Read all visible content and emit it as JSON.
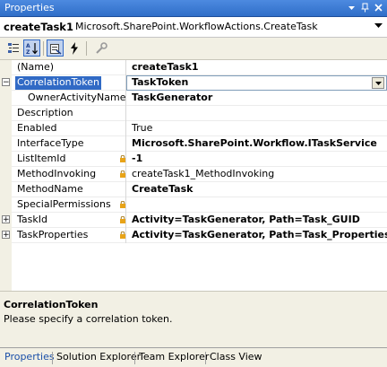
{
  "window": {
    "title": "Properties"
  },
  "object_selector": {
    "name": "createTask1",
    "type": "Microsoft.SharePoint.WorkflowActions.CreateTask"
  },
  "toolbar": {
    "buttons": [
      "categorized-icon",
      "alphabetical-icon",
      "properties-icon",
      "events-icon",
      "property-pages-icon"
    ]
  },
  "properties": [
    {
      "name": "(Name)",
      "value": "createTask1",
      "bold": true,
      "expander": "",
      "lock": false,
      "indent": false,
      "selected": false
    },
    {
      "name": "CorrelationToken",
      "value": "TaskToken",
      "bold": true,
      "expander": "−",
      "lock": false,
      "indent": false,
      "selected": true
    },
    {
      "name": "OwnerActivityName",
      "value": "TaskGenerator",
      "bold": true,
      "expander": "",
      "lock": false,
      "indent": true,
      "selected": false
    },
    {
      "name": "Description",
      "value": "",
      "bold": false,
      "expander": "",
      "lock": false,
      "indent": false,
      "selected": false
    },
    {
      "name": "Enabled",
      "value": "True",
      "bold": false,
      "expander": "",
      "lock": false,
      "indent": false,
      "selected": false
    },
    {
      "name": "InterfaceType",
      "value": "Microsoft.SharePoint.Workflow.ITaskService",
      "bold": true,
      "expander": "",
      "lock": false,
      "indent": false,
      "selected": false
    },
    {
      "name": "ListItemId",
      "value": "-1",
      "bold": true,
      "expander": "",
      "lock": true,
      "indent": false,
      "selected": false
    },
    {
      "name": "MethodInvoking",
      "value": "createTask1_MethodInvoking",
      "bold": false,
      "expander": "",
      "lock": true,
      "indent": false,
      "selected": false
    },
    {
      "name": "MethodName",
      "value": "CreateTask",
      "bold": true,
      "expander": "",
      "lock": false,
      "indent": false,
      "selected": false
    },
    {
      "name": "SpecialPermissions",
      "value": "",
      "bold": false,
      "expander": "",
      "lock": true,
      "indent": false,
      "selected": false
    },
    {
      "name": "TaskId",
      "value": "Activity=TaskGenerator, Path=Task_GUID",
      "bold": true,
      "expander": "+",
      "lock": true,
      "indent": false,
      "selected": false
    },
    {
      "name": "TaskProperties",
      "value": "Activity=TaskGenerator, Path=Task_Properties",
      "bold": true,
      "expander": "+",
      "lock": true,
      "indent": false,
      "selected": false
    }
  ],
  "description": {
    "title": "CorrelationToken",
    "text": "Please specify a correlation token."
  },
  "tabs": [
    "Properties",
    "Solution Explorer",
    "Team Explorer",
    "Class View"
  ],
  "active_tab": "Properties",
  "colors": {
    "titlebar": "#3a7bd5",
    "selection": "#316ac5",
    "panel": "#f2f0e4",
    "lock": "#e8a317",
    "active_tab": "#1a4fa8"
  }
}
